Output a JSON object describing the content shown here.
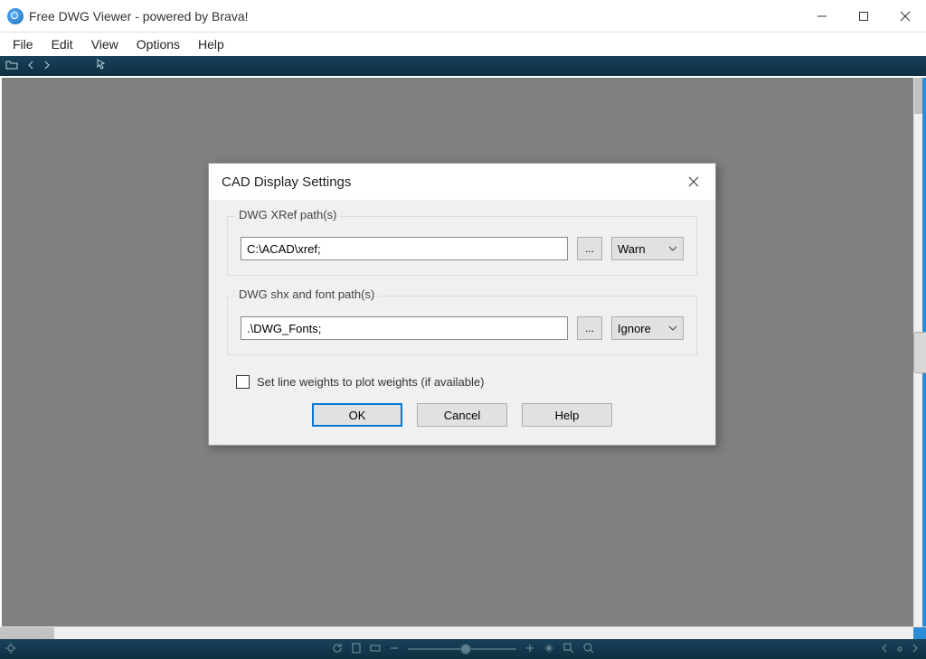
{
  "window": {
    "title": "Free DWG Viewer - powered by Brava!"
  },
  "menu": {
    "file": "File",
    "edit": "Edit",
    "view": "View",
    "options": "Options",
    "help": "Help"
  },
  "dialog": {
    "title": "CAD Display Settings",
    "xref": {
      "label": "DWG XRef path(s)",
      "value": "C:\\ACAD\\xref;",
      "browse": "...",
      "mode": "Warn"
    },
    "shx": {
      "label": "DWG shx and font path(s)",
      "value": ".\\DWG_Fonts;",
      "browse": "...",
      "mode": "Ignore"
    },
    "checkbox_label": "Set line weights to plot weights (if available)",
    "buttons": {
      "ok": "OK",
      "cancel": "Cancel",
      "help": "Help"
    }
  }
}
